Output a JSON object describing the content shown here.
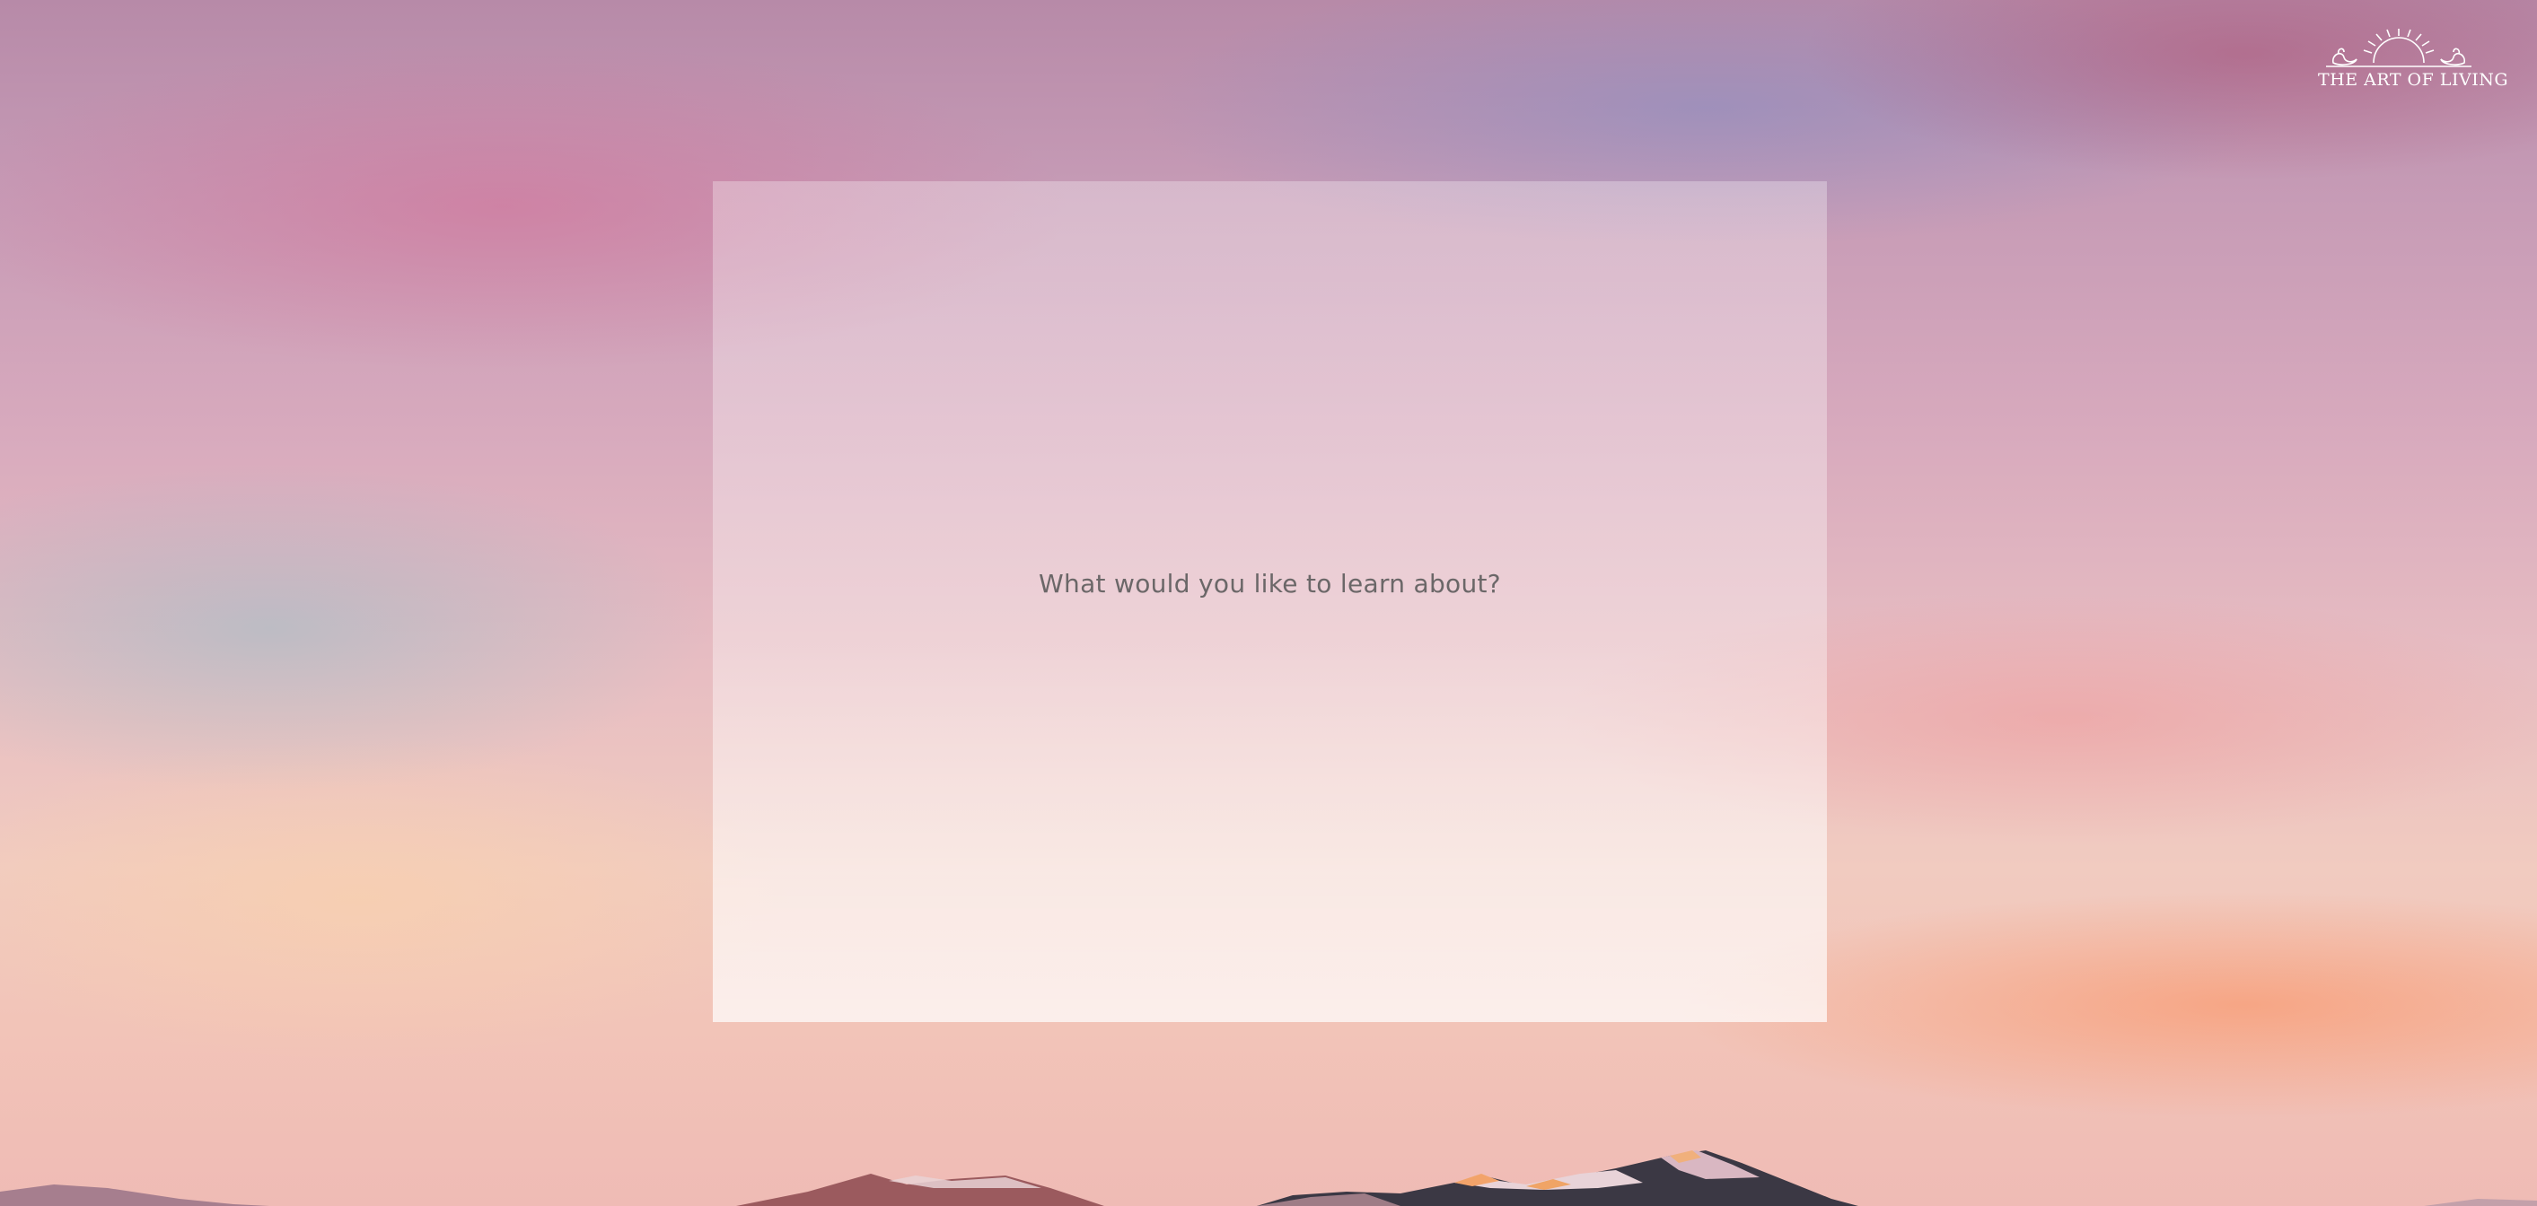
{
  "brand": {
    "logo_text": "THE ART OF LIVING"
  },
  "main": {
    "prompt": "What would you like to learn about?"
  },
  "colors": {
    "prompt_text": "#6b6768",
    "logo": "#ffffff"
  }
}
